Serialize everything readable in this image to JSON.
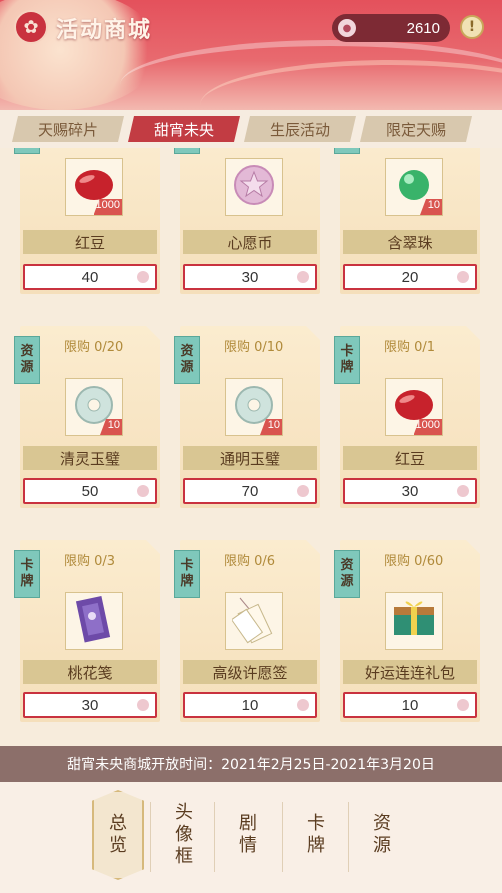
{
  "header": {
    "title": "活动商城",
    "currency_amount": "2610",
    "logo_glyph": "✿",
    "info_glyph": "!"
  },
  "tabs": [
    {
      "label": "天赐碎片",
      "active": false
    },
    {
      "label": "甜宵未央",
      "active": true
    },
    {
      "label": "生辰活动",
      "active": false
    },
    {
      "label": "限定天赐",
      "active": false
    }
  ],
  "items": [
    {
      "name": "红豆",
      "price": "40",
      "tag": "",
      "limit": "",
      "qty": "1000",
      "icon": "red-bean-icon"
    },
    {
      "name": "心愿币",
      "price": "30",
      "tag": "",
      "limit": "",
      "qty": "",
      "icon": "wish-coin-icon"
    },
    {
      "name": "含翠珠",
      "price": "20",
      "tag": "",
      "limit": "",
      "qty": "10",
      "icon": "jade-bead-icon"
    },
    {
      "name": "清灵玉璧",
      "price": "50",
      "tag": "资源",
      "limit": "限购 0/20",
      "qty": "10",
      "icon": "jade-disc-icon"
    },
    {
      "name": "通明玉璧",
      "price": "70",
      "tag": "资源",
      "limit": "限购 0/10",
      "qty": "10",
      "icon": "jade-disc-icon"
    },
    {
      "name": "红豆",
      "price": "30",
      "tag": "卡牌",
      "limit": "限购 0/1",
      "qty": "1000",
      "icon": "red-bean-icon"
    },
    {
      "name": "桃花笺",
      "price": "30",
      "tag": "卡牌",
      "limit": "限购 0/3",
      "qty": "",
      "icon": "letter-icon"
    },
    {
      "name": "高级许愿签",
      "price": "10",
      "tag": "卡牌",
      "limit": "限购 0/6",
      "qty": "",
      "icon": "wish-tag-icon"
    },
    {
      "name": "好运连连礼包",
      "price": "10",
      "tag": "资源",
      "limit": "限购 0/60",
      "qty": "",
      "icon": "gift-box-icon"
    }
  ],
  "notice": "甜宵未央商城开放时间：2021年2月25日-2021年3月20日",
  "bottom_nav": [
    {
      "label": [
        "总",
        "览"
      ],
      "active": true
    },
    {
      "label": [
        "头",
        "像",
        "框"
      ],
      "active": false
    },
    {
      "label": [
        "剧",
        "情"
      ],
      "active": false
    },
    {
      "label": [
        "卡",
        "牌"
      ],
      "active": false
    },
    {
      "label": [
        "资",
        "源"
      ],
      "active": false
    }
  ],
  "colors": {
    "accent_red": "#c9323f",
    "tag_teal": "#7fc8bb",
    "card_cream": "#fbeccf",
    "name_bar": "#d9c693"
  }
}
